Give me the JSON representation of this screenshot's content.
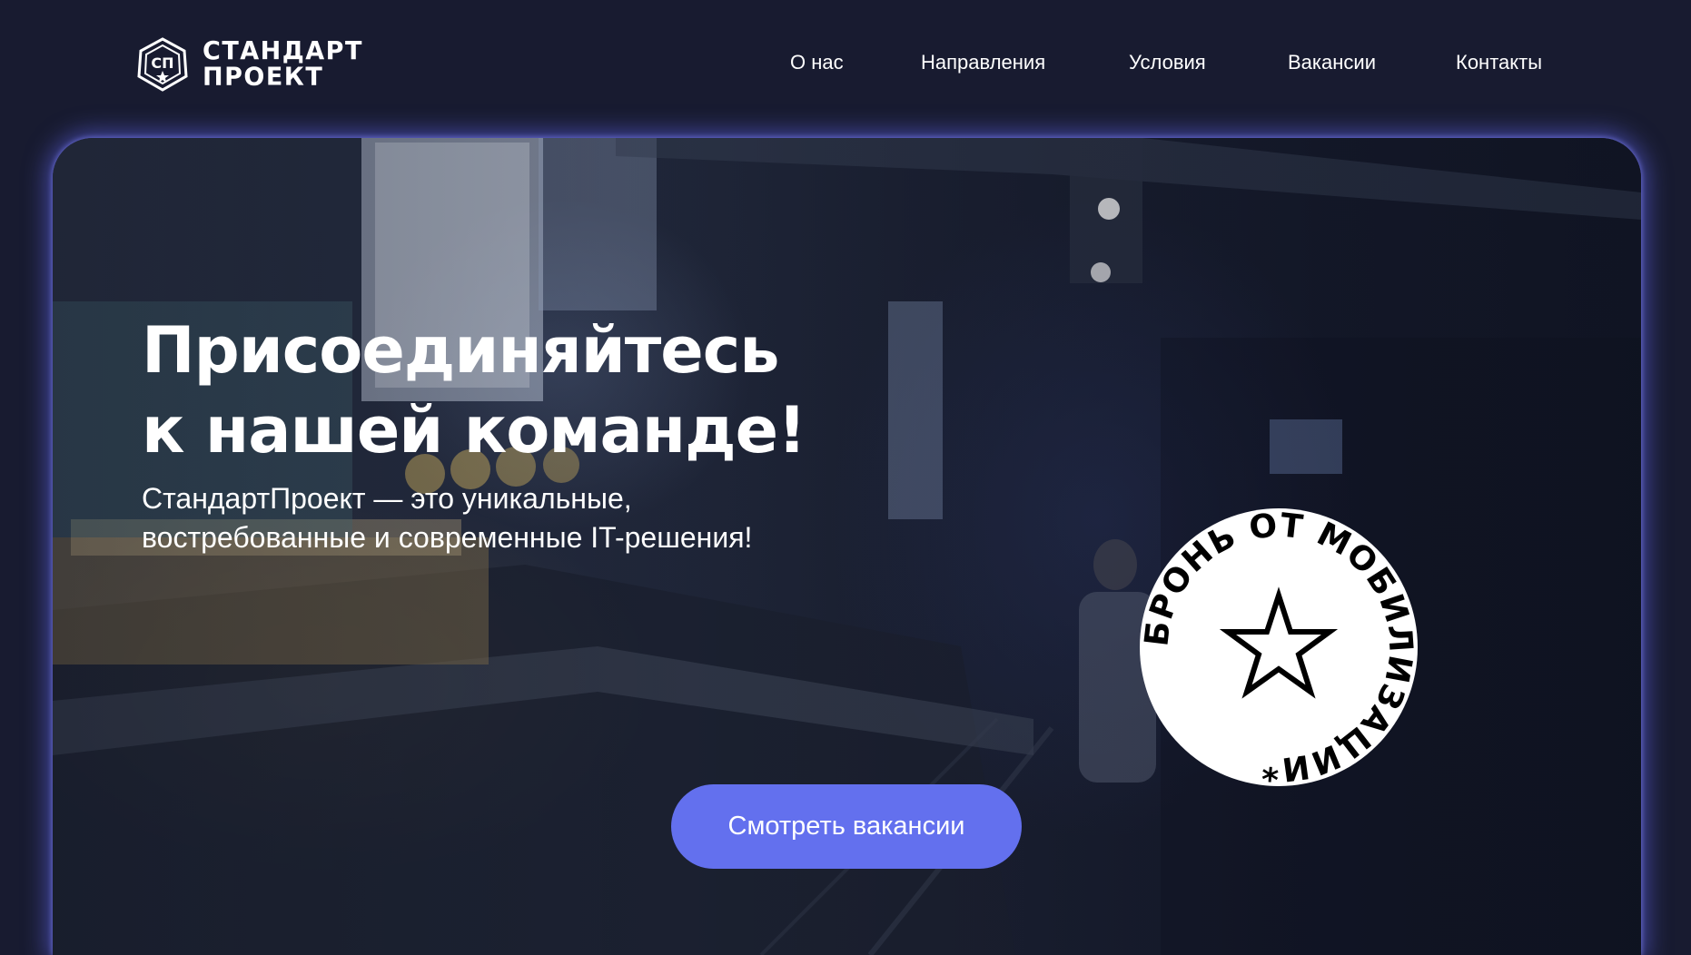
{
  "header": {
    "logo": {
      "line1": "СТАНДАРТ",
      "line2": "ПРОЕКТ",
      "mark_text": "СП"
    },
    "nav": [
      {
        "label": "О нас"
      },
      {
        "label": "Направления"
      },
      {
        "label": "Условия"
      },
      {
        "label": "Вакансии"
      },
      {
        "label": "Контакты"
      }
    ]
  },
  "hero": {
    "title_line1": "Присоединяйтесь",
    "title_line2": "к нашей команде!",
    "subtitle_line1": "СтандартПроект — это уникальные,",
    "subtitle_line2": "востребованные и современные IT-решения!",
    "cta_label": "Смотреть вакансии",
    "badge_text": "БРОНЬ ОТ МОБИЛИЗАЦИИ*",
    "badge_icon": "star-icon"
  },
  "colors": {
    "background": "#181b30",
    "accent": "#6370ee",
    "hero_glow": "#696eff",
    "text": "#ffffff",
    "badge_fill": "#ffffff",
    "badge_ink": "#000000"
  }
}
